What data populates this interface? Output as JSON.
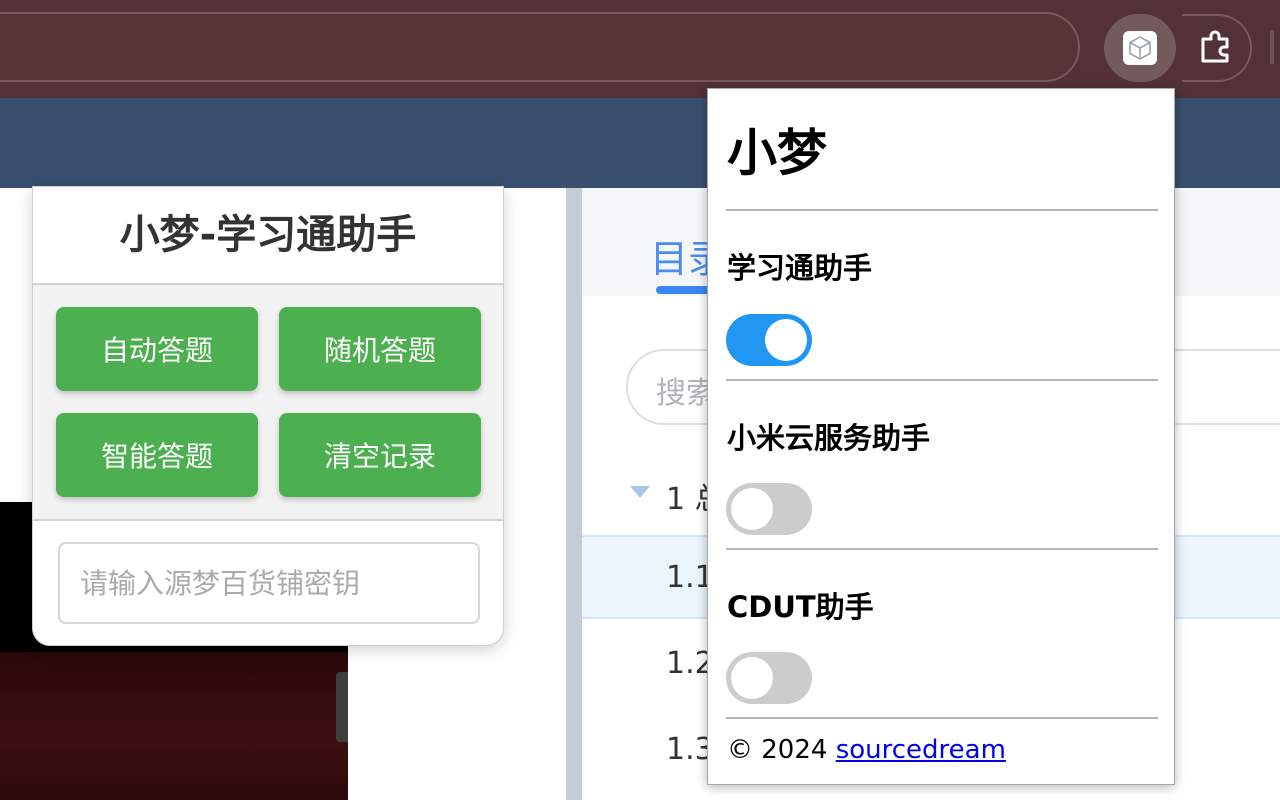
{
  "browser": {
    "extension_icon": "cube-icon",
    "puzzle_icon": "puzzle-icon"
  },
  "helper_panel": {
    "title": "小梦-学习通助手",
    "buttons": {
      "auto_answer": "自动答题",
      "random_answer": "随机答题",
      "smart_answer": "智能答题",
      "clear_records": "清空记录"
    },
    "key_input_placeholder": "请输入源梦百货铺密钥",
    "button_color": "#4caf50"
  },
  "page": {
    "tab_label": "目录",
    "search_placeholder": "搜索",
    "tree": {
      "chapter": "1 总",
      "items": [
        "1.1",
        "1.2",
        "1.3"
      ]
    }
  },
  "popup": {
    "title": "小梦",
    "sections": [
      {
        "label": "学习通助手",
        "enabled": true
      },
      {
        "label": "小米云服务助手",
        "enabled": false
      },
      {
        "label": "CDUT助手",
        "enabled": false
      }
    ],
    "footer_prefix": "© 2024",
    "footer_link": "sourcedream",
    "switch_on_color": "#2196f3",
    "switch_off_color": "#cccccc"
  }
}
